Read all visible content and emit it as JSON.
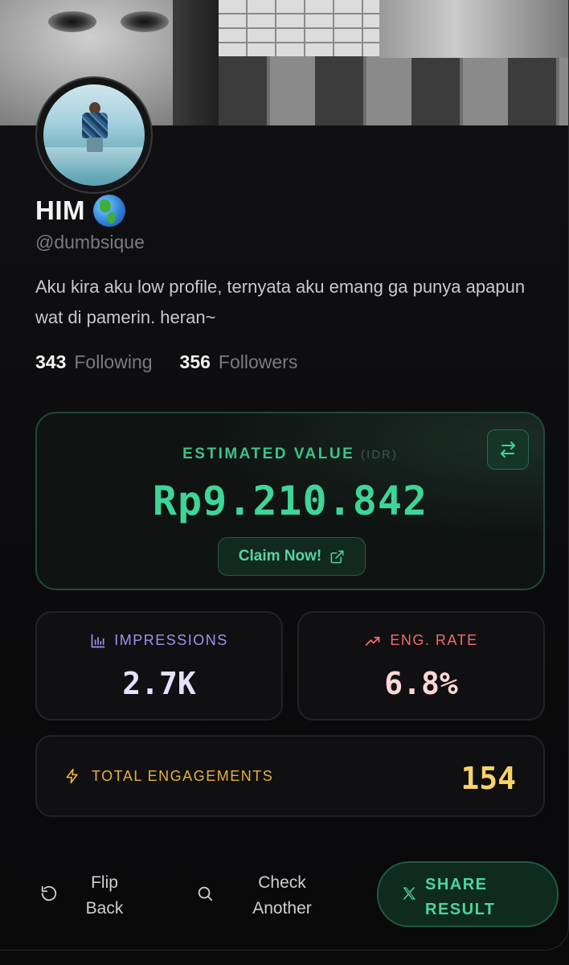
{
  "profile": {
    "name": "HIM",
    "handle": "@dumbsique",
    "bio": "Aku kira aku low profile, ternyata aku emang ga punya apapun wat di pamerin. heran~",
    "following_count": "343",
    "following_label": "Following",
    "followers_count": "356",
    "followers_label": "Followers"
  },
  "valuation": {
    "label": "ESTIMATED VALUE",
    "unit": "(IDR)",
    "amount": "Rp9.210.842",
    "claim_label": "Claim Now!"
  },
  "metrics": {
    "impressions_label": "IMPRESSIONS",
    "impressions_value": "2.7K",
    "eng_rate_label": "ENG. RATE",
    "eng_rate_value": "6.8%",
    "total_label": "TOTAL ENGAGEMENTS",
    "total_value": "154"
  },
  "actions": {
    "flip_line1": "Flip",
    "flip_line2": "Back",
    "check_line1": "Check",
    "check_line2": "Another",
    "share_line1": "SHARE",
    "share_line2": "RESULT"
  },
  "icons": {
    "name_emoji": "globe-icon",
    "swap": "swap-arrows-icon",
    "external": "external-link-icon",
    "impressions": "bar-chart-icon",
    "eng_rate": "trending-up-icon",
    "total": "lightning-icon",
    "flip": "rotate-ccw-icon",
    "check": "search-icon",
    "share": "x-logo-icon"
  },
  "colors": {
    "accent_green": "#3ed598",
    "impressions": "#a88ef0",
    "eng_rate": "#ee6d6d",
    "total": "#e8b13a",
    "background": "#0a0a0b"
  }
}
